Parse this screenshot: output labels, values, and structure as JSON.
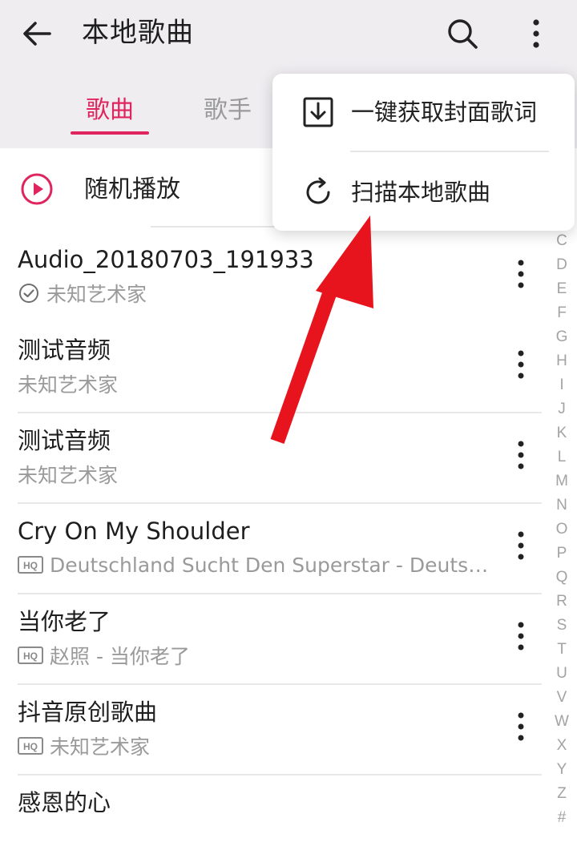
{
  "header": {
    "title": "本地歌曲",
    "back_icon": "arrow-back-icon",
    "search_icon": "search-icon",
    "more_icon": "more-vert-icon"
  },
  "tabs": [
    {
      "label": "歌曲",
      "active": true
    },
    {
      "label": "歌手",
      "active": false
    }
  ],
  "shuffle": {
    "label": "随机播放",
    "icon": "play-circle-icon"
  },
  "songs": [
    {
      "title": "Audio_20180703_191933",
      "subtitle": "未知艺术家",
      "badge": "check-circle"
    },
    {
      "title": "测试音频",
      "subtitle": "未知艺术家",
      "badge": ""
    },
    {
      "title": "测试音频",
      "subtitle": "未知艺术家",
      "badge": ""
    },
    {
      "title": "Cry On My Shoulder",
      "subtitle": "Deutschland Sucht Den Superstar - Deutschla...",
      "badge": "HQ"
    },
    {
      "title": "当你老了",
      "subtitle": "赵照 - 当你老了",
      "badge": "HQ"
    },
    {
      "title": "抖音原创歌曲",
      "subtitle": "未知艺术家",
      "badge": "HQ"
    },
    {
      "title": "感恩的心",
      "subtitle": "",
      "badge": ""
    }
  ],
  "alpha_index": [
    "C",
    "D",
    "E",
    "F",
    "G",
    "H",
    "I",
    "J",
    "K",
    "L",
    "M",
    "N",
    "O",
    "P",
    "Q",
    "R",
    "S",
    "T",
    "U",
    "V",
    "W",
    "X",
    "Y",
    "Z",
    "#"
  ],
  "popup_menu": [
    {
      "label": "一键获取封面歌词",
      "icon": "download-box-icon"
    },
    {
      "label": "扫描本地歌曲",
      "icon": "refresh-icon"
    }
  ],
  "colors": {
    "accent": "#e0245e",
    "annotation_arrow": "#e8141d",
    "appbar_bg": "#efedf0"
  }
}
